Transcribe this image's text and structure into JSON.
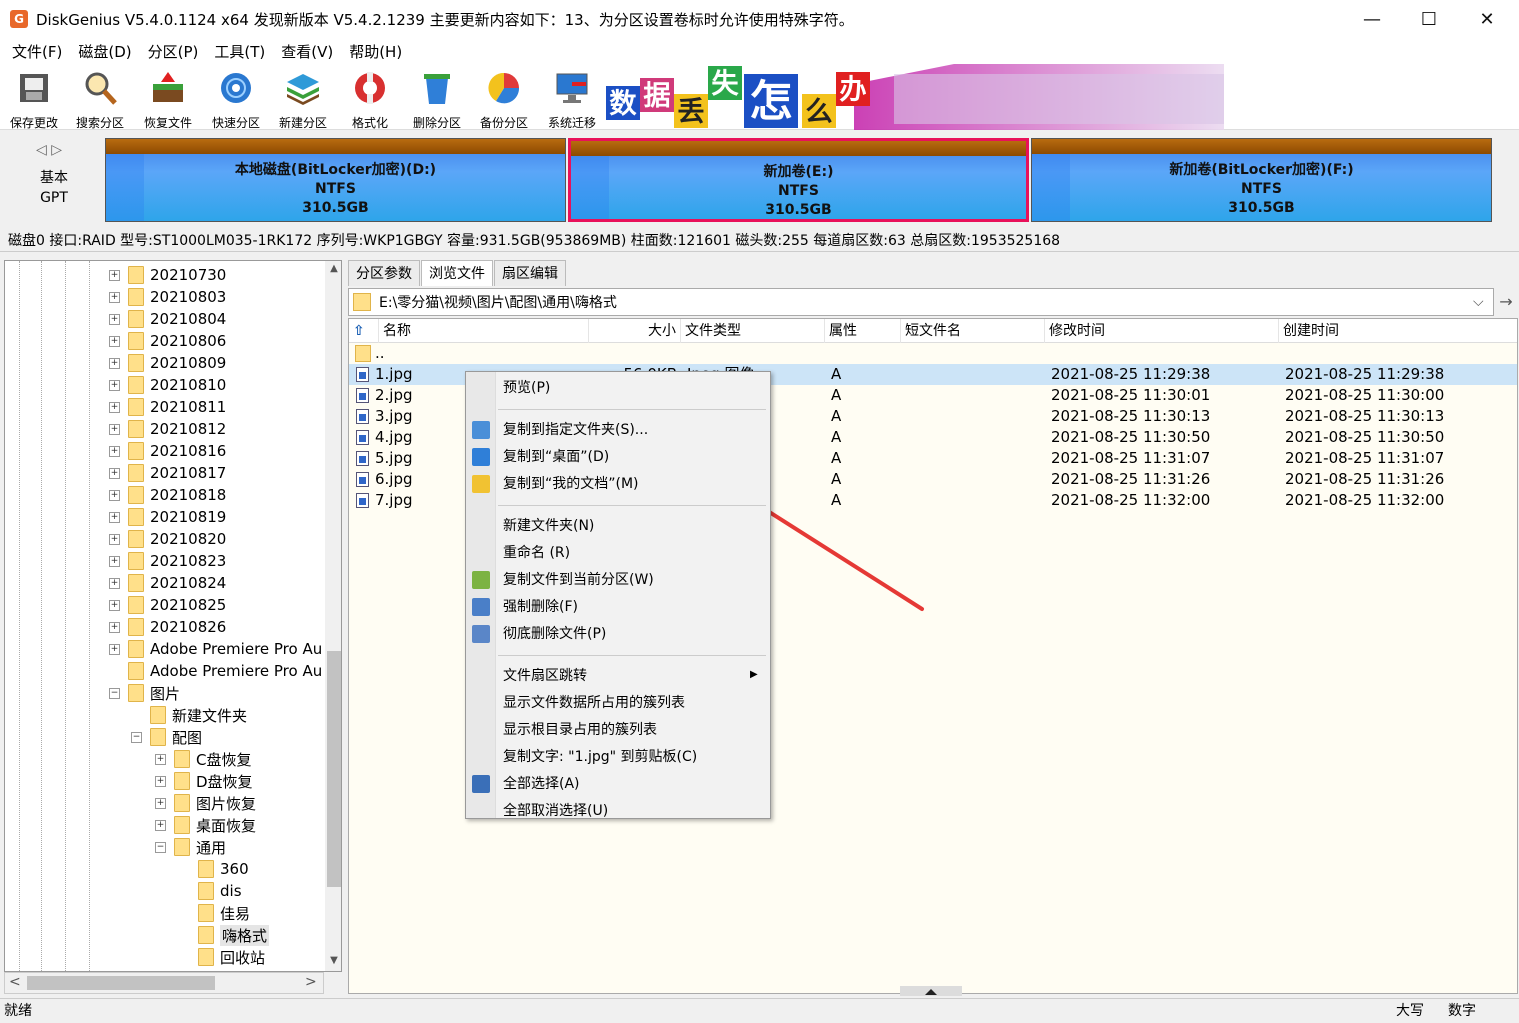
{
  "window": {
    "title": "DiskGenius V5.4.0.1124 x64   发现新版本 V5.4.2.1239 主要更新内容如下：13、为分区设置卷标时允许使用特殊字符。",
    "app_icon": "G",
    "minimize": "—",
    "maximize": "☐",
    "close": "✕"
  },
  "menu": [
    "文件(F)",
    "磁盘(D)",
    "分区(P)",
    "工具(T)",
    "查看(V)",
    "帮助(H)"
  ],
  "toolbar": [
    {
      "label": "保存更改",
      "icon": "save-icon"
    },
    {
      "label": "搜索分区",
      "icon": "magnifier-icon"
    },
    {
      "label": "恢复文件",
      "icon": "recover-icon"
    },
    {
      "label": "快速分区",
      "icon": "disc-icon"
    },
    {
      "label": "新建分区",
      "icon": "layers-icon"
    },
    {
      "label": "格式化",
      "icon": "lifebuoy-icon"
    },
    {
      "label": "删除分区",
      "icon": "trash-icon"
    },
    {
      "label": "备份分区",
      "icon": "pie-icon"
    },
    {
      "label": "系统迁移",
      "icon": "monitor-icon"
    }
  ],
  "banner": {
    "chars": [
      "数",
      "据",
      "丢",
      "失",
      "怎",
      "么",
      "办"
    ]
  },
  "disk": {
    "nav": "◁ ▷",
    "kind_line1": "基本",
    "kind_line2": "GPT",
    "partitions": [
      {
        "name": "本地磁盘(BitLocker加密)(D:)",
        "fs": "NTFS",
        "size": "310.5GB"
      },
      {
        "name": "新加卷(E:)",
        "fs": "NTFS",
        "size": "310.5GB"
      },
      {
        "name": "新加卷(BitLocker加密)(F:)",
        "fs": "NTFS",
        "size": "310.5GB"
      }
    ],
    "info": "磁盘0 接口:RAID  型号:ST1000LM035-1RK172  序列号:WKP1GBGY  容量:931.5GB(953869MB)  柱面数:121601  磁头数:255  每道扇区数:63  总扇区数:1953525168"
  },
  "tree": {
    "items": [
      {
        "label": "20210730",
        "depth": 0,
        "exp": "+"
      },
      {
        "label": "20210803",
        "depth": 0,
        "exp": "+"
      },
      {
        "label": "20210804",
        "depth": 0,
        "exp": "+"
      },
      {
        "label": "20210806",
        "depth": 0,
        "exp": "+"
      },
      {
        "label": "20210809",
        "depth": 0,
        "exp": "+"
      },
      {
        "label": "20210810",
        "depth": 0,
        "exp": "+"
      },
      {
        "label": "20210811",
        "depth": 0,
        "exp": "+"
      },
      {
        "label": "20210812",
        "depth": 0,
        "exp": "+"
      },
      {
        "label": "20210816",
        "depth": 0,
        "exp": "+"
      },
      {
        "label": "20210817",
        "depth": 0,
        "exp": "+"
      },
      {
        "label": "20210818",
        "depth": 0,
        "exp": "+"
      },
      {
        "label": "20210819",
        "depth": 0,
        "exp": "+"
      },
      {
        "label": "20210820",
        "depth": 0,
        "exp": "+"
      },
      {
        "label": "20210823",
        "depth": 0,
        "exp": "+"
      },
      {
        "label": "20210824",
        "depth": 0,
        "exp": "+"
      },
      {
        "label": "20210825",
        "depth": 0,
        "exp": "+"
      },
      {
        "label": "20210826",
        "depth": 0,
        "exp": "+"
      },
      {
        "label": "Adobe Premiere Pro Au",
        "depth": 0,
        "exp": "+"
      },
      {
        "label": "Adobe Premiere Pro Au",
        "depth": 0,
        "exp": ""
      },
      {
        "label": "图片",
        "depth": 0,
        "exp": "−"
      },
      {
        "label": "新建文件夹",
        "depth": 1,
        "exp": ""
      },
      {
        "label": "配图",
        "depth": 1,
        "exp": "−"
      },
      {
        "label": "C盘恢复",
        "depth": 2,
        "exp": "+"
      },
      {
        "label": "D盘恢复",
        "depth": 2,
        "exp": "+"
      },
      {
        "label": "图片恢复",
        "depth": 2,
        "exp": "+"
      },
      {
        "label": "桌面恢复",
        "depth": 2,
        "exp": "+"
      },
      {
        "label": "通用",
        "depth": 2,
        "exp": "−"
      },
      {
        "label": "360",
        "depth": 3,
        "exp": ""
      },
      {
        "label": "dis",
        "depth": 3,
        "exp": ""
      },
      {
        "label": "佳易",
        "depth": 3,
        "exp": ""
      },
      {
        "label": "嗨格式",
        "depth": 3,
        "exp": "",
        "selected": true
      },
      {
        "label": "回收站",
        "depth": 3,
        "exp": ""
      }
    ],
    "scroll_up": "▲",
    "scroll_down": "▼",
    "scroll_left": "<",
    "scroll_right": ">"
  },
  "tabs": [
    "分区参数",
    "浏览文件",
    "扇区编辑"
  ],
  "path": {
    "value": "E:\\零分猫\\视频\\图片\\配图\\通用\\嗨格式",
    "dropdown": "⌵",
    "go": "→"
  },
  "columns": {
    "up": "⇧",
    "name": "名称",
    "size": "大小",
    "type": "文件类型",
    "attr": "属性",
    "short": "短文件名",
    "modified": "修改时间",
    "created": "创建时间"
  },
  "files": [
    {
      "name": "..",
      "size": "",
      "type": "",
      "attr": "",
      "modified": "",
      "created": "",
      "folder": true
    },
    {
      "name": "1.jpg",
      "size": "56.0KB",
      "type": "Jpeg 图像",
      "attr": "A",
      "modified": "2021-08-25 11:29:38",
      "created": "2021-08-25 11:29:38",
      "selected": true
    },
    {
      "name": "2.jpg",
      "size": "",
      "type": "",
      "attr": "A",
      "modified": "2021-08-25 11:30:01",
      "created": "2021-08-25 11:30:00"
    },
    {
      "name": "3.jpg",
      "size": "",
      "type": "",
      "attr": "A",
      "modified": "2021-08-25 11:30:13",
      "created": "2021-08-25 11:30:13"
    },
    {
      "name": "4.jpg",
      "size": "",
      "type": "",
      "attr": "A",
      "modified": "2021-08-25 11:30:50",
      "created": "2021-08-25 11:30:50"
    },
    {
      "name": "5.jpg",
      "size": "",
      "type": "",
      "attr": "A",
      "modified": "2021-08-25 11:31:07",
      "created": "2021-08-25 11:31:07"
    },
    {
      "name": "6.jpg",
      "size": "",
      "type": "",
      "attr": "A",
      "modified": "2021-08-25 11:31:26",
      "created": "2021-08-25 11:31:26"
    },
    {
      "name": "7.jpg",
      "size": "",
      "type": "",
      "attr": "A",
      "modified": "2021-08-25 11:32:00",
      "created": "2021-08-25 11:32:00"
    }
  ],
  "context_menu": {
    "items": [
      {
        "label": "预览(P)",
        "icon": ""
      },
      {
        "sep": true
      },
      {
        "label": "复制到指定文件夹(S)...",
        "icon": "copy-to-folder-icon",
        "color": "#4a8fd8"
      },
      {
        "label": "复制到“桌面”(D)",
        "icon": "desktop-icon",
        "color": "#2f7fd8"
      },
      {
        "label": "复制到“我的文档”(M)",
        "icon": "folder-icon",
        "color": "#f1c232"
      },
      {
        "sep": true
      },
      {
        "label": "新建文件夹(N)",
        "icon": ""
      },
      {
        "label": "重命名 (R)",
        "icon": ""
      },
      {
        "label": "复制文件到当前分区(W)",
        "icon": "pie-chart-icon",
        "color": "#7cb342"
      },
      {
        "label": "强制删除(F)",
        "icon": "document-icon",
        "color": "#4a7fc8"
      },
      {
        "label": "彻底删除文件(P)",
        "icon": "shredder-icon",
        "color": "#5a86c8"
      },
      {
        "sep": true
      },
      {
        "label": "文件扇区跳转",
        "icon": "",
        "submenu": "▶"
      },
      {
        "label": "显示文件数据所占用的簇列表",
        "icon": ""
      },
      {
        "label": "显示根目录占用的簇列表",
        "icon": ""
      },
      {
        "label": "复制文字: \"1.jpg\" 到剪贴板(C)",
        "icon": ""
      },
      {
        "label": "全部选择(A)",
        "icon": "checkbox-icon",
        "color": "#3a6fb8"
      },
      {
        "label": "全部取消选择(U)",
        "icon": ""
      }
    ]
  },
  "colors": {
    "annotation_arrow": "#e53935",
    "partition_highlight": "#e8115a"
  },
  "status": {
    "left": "就绪",
    "caps": "大写",
    "num": "数字"
  }
}
